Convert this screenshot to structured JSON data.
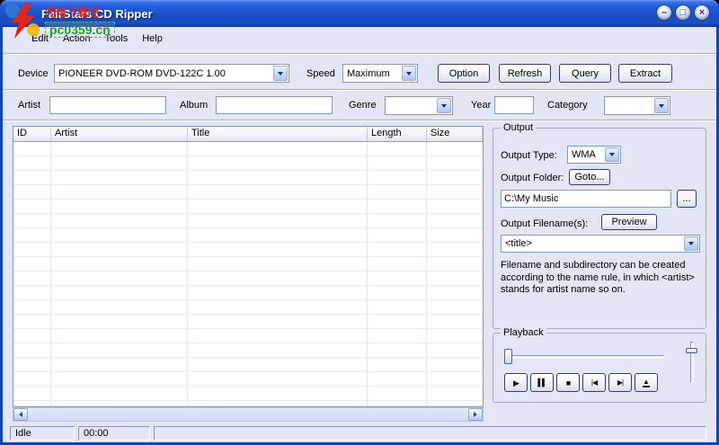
{
  "window": {
    "title": "FairStars CD Ripper"
  },
  "watermark": {
    "site_name": "闪电下载吧",
    "site_url": "pc0359.cn"
  },
  "menu_bar": {
    "items": [
      "Edit",
      "Action",
      "Tools",
      "Help"
    ]
  },
  "device_bar": {
    "device_label": "Device",
    "device_value": "PIONEER DVD-ROM DVD-122C 1.00",
    "speed_label": "Speed",
    "speed_value": "Maximum",
    "option_button": "Option",
    "refresh_button": "Refresh",
    "query_button": "Query",
    "extract_button": "Extract"
  },
  "track_info_bar": {
    "artist_label": "Artist",
    "artist_value": "",
    "album_label": "Album",
    "album_value": "",
    "genre_label": "Genre",
    "genre_value": "",
    "year_label": "Year",
    "year_value": "",
    "category_label": "Category",
    "category_value": ""
  },
  "track_list": {
    "columns": [
      "ID",
      "Artist",
      "Title",
      "Length",
      "Size"
    ],
    "rows": []
  },
  "output_panel": {
    "title": "Output",
    "output_type_label": "Output Type:",
    "output_type_value": "WMA",
    "output_folder_label": "Output Folder:",
    "goto_button": "Goto...",
    "folder_path": "C:\\My Music",
    "browse_button": "...",
    "filename_label": "Output Filename(s):",
    "preview_button": "Preview",
    "filename_pattern": "<title>",
    "help_text": "Filename and subdirectory can be created according to the name rule, in which <artist> stands for artist name so on."
  },
  "playback_panel": {
    "title": "Playback"
  },
  "status_bar": {
    "status": "Idle",
    "time": "00:00",
    "info": ""
  },
  "icons": {
    "minimize": "–",
    "maximize": "□",
    "close": "×",
    "play": "▶",
    "pause": "▌▌",
    "stop": "■",
    "previous": "|◀",
    "next": "▶|",
    "eject": "▲"
  },
  "colors": {
    "titlebar_top": "#5E91F2",
    "titlebar_bottom": "#123A9B",
    "client_bg": "#E3E6F4",
    "accent_border": "#1144B8",
    "watermark_red": "#E1251B",
    "watermark_green": "#1BA126"
  }
}
